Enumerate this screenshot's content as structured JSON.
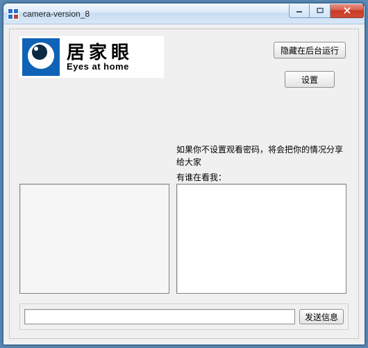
{
  "window": {
    "title": "camera-version_8"
  },
  "logo": {
    "cn": "居家眼",
    "en": "Eyes at home"
  },
  "buttons": {
    "hide_background": "隐藏在后台运行",
    "settings": "设置",
    "send": "发送信息"
  },
  "texts": {
    "info": "如果你不设置观看密码，将会把你的情况分享给大家",
    "watch_label": "有谁在看我："
  },
  "input": {
    "message_value": ""
  }
}
